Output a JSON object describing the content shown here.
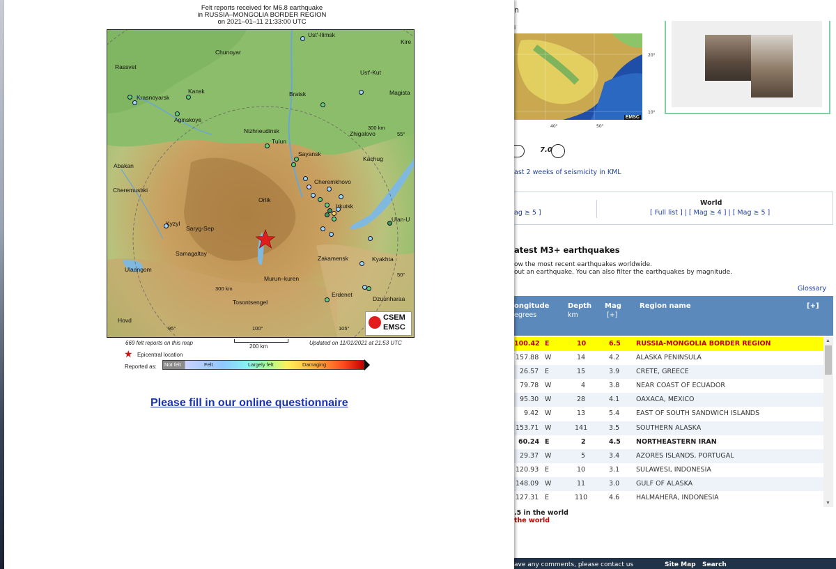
{
  "felt_report": {
    "title_line1": "Felt reports received for M6.8 earthquake",
    "title_line2": "in RUSSIA–MONGOLIA BORDER REGION",
    "title_line3": "on  2021–01–11 21:33:00 UTC",
    "cities": [
      "Ust'-Ilimsk",
      "Kire",
      "Chunoyar",
      "Rassvet",
      "Ust'-Kut",
      "Kansk",
      "Bratsk",
      "Magista",
      "Krasnoyarsk",
      "Aginskoye",
      "Nizhneudinsk",
      "Zhigalovo",
      "Tulun",
      "Sayansk",
      "Kachug",
      "Abakan",
      "Cheremkhovo",
      "Cheremushki",
      "Orlik",
      "Irkutsk",
      "Ulan-U",
      "Kyzyl",
      "Saryg-Sep",
      "Samagaltay",
      "Zakamensk",
      "Kyakhta",
      "Ulaangom",
      "Murun–kuren",
      "Erdenet",
      "Tosontsengel",
      "Dzuunharaa",
      "Hovd"
    ],
    "map_labels": {
      "km300_top": "300 km",
      "km300_bottom": "300 km",
      "lat55": "55°",
      "lat50": "50°",
      "lon95": "95°",
      "lon100": "100°",
      "lon105": "105°"
    },
    "logo_top": "CSEM",
    "logo_bottom": "EMSC",
    "count_text": "669 felt reports on this map",
    "scale_text": "200 km",
    "updated_text": "Updated on 11/01/2021 at 21:53 UTC",
    "epicenter_label": "Epicentral location",
    "reported_as": "Reported as:",
    "legend": {
      "not_felt": "Not felt",
      "felt": "Felt",
      "largely_felt": "Largely felt",
      "damaging": "Damaging"
    },
    "questionnaire": "Please fill in our online questionnaire"
  },
  "site": {
    "n_fragment": "n",
    "i_fragment": "i",
    "map_coords": [
      "20°",
      "10°",
      "40°",
      "50°"
    ],
    "map_logo": "EMSC",
    "mag_circle": "7.0",
    "kml_text": "ast 2 weeks of seismicity in KML",
    "left_links": "ag ≥ 5 ]",
    "world_title": "World",
    "world_links": "[ Full list ] | [ Mag ≥ 4 ] | [ Mag ≥ 5 ]",
    "latest_title": "atest M3+ earthquakes",
    "latest_desc1": "ow the most recent earthquakes worldwide.",
    "latest_desc2": "out an earthquake. You can also filter the earthquakes by magnitude.",
    "glossary": "Glossary",
    "headers": {
      "lon": "ongitude",
      "lon_sub": "egrees",
      "depth": "Depth",
      "depth_sub": "km",
      "mag": "Mag",
      "mag_sub": "[+]",
      "region": "Region name",
      "plus": "[+]"
    },
    "quakes": [
      {
        "lon": "100.42",
        "dir": "E",
        "depth": "10",
        "mag": "6.5",
        "region": "RUSSIA-MONGOLIA BORDER REGION"
      },
      {
        "lon": "157.88",
        "dir": "W",
        "depth": "14",
        "mag": "4.2",
        "region": "ALASKA PENINSULA"
      },
      {
        "lon": "26.57",
        "dir": "E",
        "depth": "15",
        "mag": "3.9",
        "region": "CRETE, GREECE"
      },
      {
        "lon": "79.78",
        "dir": "W",
        "depth": "4",
        "mag": "3.8",
        "region": "NEAR COAST OF ECUADOR"
      },
      {
        "lon": "95.30",
        "dir": "W",
        "depth": "28",
        "mag": "4.1",
        "region": "OAXACA, MEXICO"
      },
      {
        "lon": "9.42",
        "dir": "W",
        "depth": "13",
        "mag": "5.4",
        "region": "EAST OF SOUTH SANDWICH ISLANDS"
      },
      {
        "lon": "153.71",
        "dir": "W",
        "depth": "141",
        "mag": "3.5",
        "region": "SOUTHERN ALASKA"
      },
      {
        "lon": "60.24",
        "dir": "E",
        "depth": "2",
        "mag": "4.5",
        "region": "NORTHEASTERN IRAN"
      },
      {
        "lon": "29.37",
        "dir": "W",
        "depth": "5",
        "mag": "3.4",
        "region": "AZORES ISLANDS, PORTUGAL"
      },
      {
        "lon": "120.93",
        "dir": "E",
        "depth": "10",
        "mag": "3.1",
        "region": "SULAWESI, INDONESIA"
      },
      {
        "lon": "148.09",
        "dir": "W",
        "depth": "11",
        "mag": "3.0",
        "region": "GULF OF ALASKA"
      },
      {
        "lon": "127.31",
        "dir": "E",
        "depth": "110",
        "mag": "4.6",
        "region": "HALMAHERA, INDONESIA"
      }
    ],
    "world_line1": ".5 in the world",
    "world_line2": "the world",
    "footer_contact": "ave any comments, please contact us",
    "footer_sitemap": "Site Map",
    "footer_search": "Search"
  }
}
